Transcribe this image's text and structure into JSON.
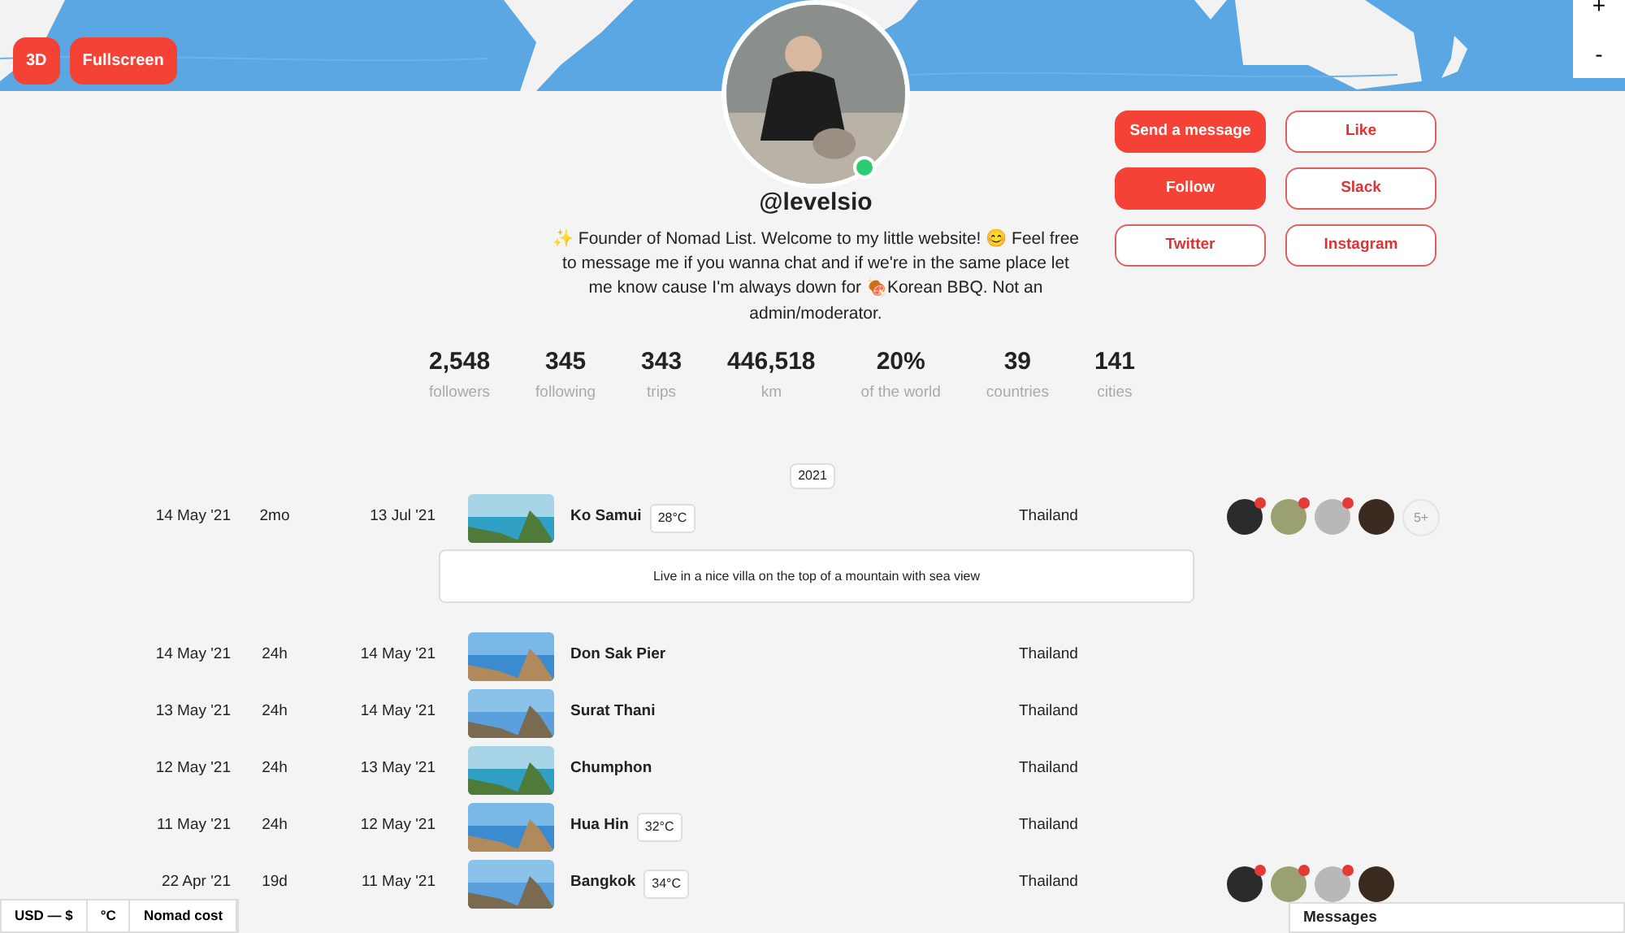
{
  "map": {
    "kind": "picture",
    "buttons": [
      {
        "label": "3D"
      },
      {
        "label": "Fullscreen"
      }
    ],
    "zoom_controls": [
      "+",
      "-"
    ]
  },
  "profile": {
    "online": true,
    "username": "@levelsio",
    "bio": "✨ Founder of Nomad List. Welcome to my little website! 😊 Feel free to message me if you wanna chat and if we're in the same place let me know cause I'm always down for 🍖Korean BBQ. Not an admin/moderator.",
    "actions": [
      {
        "label": "Send a message",
        "primary": true
      },
      {
        "label": "Like",
        "primary": false
      },
      {
        "label": "Follow",
        "primary": true
      },
      {
        "label": "Slack",
        "primary": false
      },
      {
        "label": "Twitter",
        "primary": false
      },
      {
        "label": "Instagram",
        "primary": false
      }
    ],
    "stats": [
      {
        "value": "2,548",
        "label": "followers"
      },
      {
        "value": "345",
        "label": "following"
      },
      {
        "value": "343",
        "label": "trips"
      },
      {
        "value": "446,518",
        "label": "km"
      },
      {
        "value": "20%",
        "label": "of the world"
      },
      {
        "value": "39",
        "label": "countries"
      },
      {
        "value": "141",
        "label": "cities"
      }
    ]
  },
  "year": "2021",
  "trips": [
    {
      "start": "14 May '21",
      "duration": "2mo",
      "end": "13 Jul '21",
      "city": "Ko Samui",
      "temperature": "28°C",
      "country": "Thailand",
      "travelers": [
        {
          "notified": true
        },
        {
          "notified": true
        },
        {
          "notified": true
        },
        {
          "notified": false
        }
      ],
      "more": "5+",
      "note": "Live in a nice villa on the top of a mountain with sea view"
    },
    {
      "start": "14 May '21",
      "duration": "24h",
      "end": "14 May '21",
      "city": "Don Sak Pier",
      "country": "Thailand"
    },
    {
      "start": "13 May '21",
      "duration": "24h",
      "end": "14 May '21",
      "city": "Surat Thani",
      "country": "Thailand"
    },
    {
      "start": "12 May '21",
      "duration": "24h",
      "end": "13 May '21",
      "city": "Chumphon",
      "country": "Thailand"
    },
    {
      "start": "11 May '21",
      "duration": "24h",
      "end": "12 May '21",
      "city": "Hua Hin",
      "temperature": "32°C",
      "country": "Thailand"
    },
    {
      "start": "22 Apr '21",
      "duration": "19d",
      "end": "11 May '21",
      "city": "Bangkok",
      "temperature": "34°C",
      "country": "Thailand",
      "travelers": [
        {
          "notified": true
        },
        {
          "notified": true
        },
        {
          "notified": true
        },
        {
          "notified": false
        }
      ]
    }
  ],
  "footer": {
    "settings": [
      "USD — $",
      "°C",
      "Nomad cost"
    ],
    "messages": "Messages"
  }
}
